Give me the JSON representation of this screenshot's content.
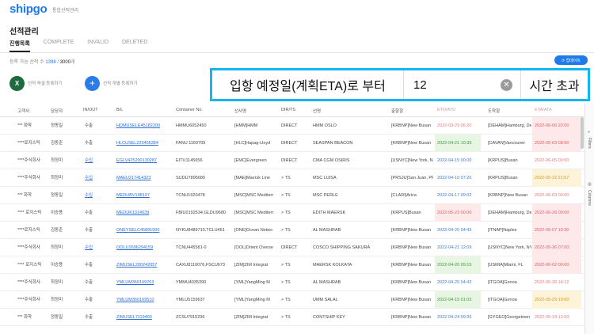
{
  "header": {
    "logo": "shipgo",
    "logo_sub": "통합선적관리"
  },
  "page": {
    "title": "선적관리",
    "tabs": [
      {
        "label": "진행목록",
        "active": true
      },
      {
        "label": "COMPLETE",
        "active": false
      },
      {
        "label": "INVALID",
        "active": false
      },
      {
        "label": "DELETED",
        "active": false
      }
    ],
    "count_prefix": "등록 가능 선적 수 ",
    "count_used": "1398",
    "count_slash": " / ",
    "count_total": "3000",
    "count_suffix": "개",
    "update_button": "⟳ 업데이트"
  },
  "actions": {
    "excel_label": "선적 엑셀 등록하기",
    "single_label": "선적 개별 등록하기"
  },
  "filter": {
    "label": "입항 예정일(계획ETA)로 부터",
    "value": "12",
    "unit": "시간 초과"
  },
  "table": {
    "columns": {
      "customer": "고객사",
      "manager": "담당자",
      "inout": "IN/OUT",
      "bl": "B/L",
      "container": "Container No.",
      "carrier": "선사명",
      "dirts": "DIR/TS",
      "vessel": "선명",
      "pol": "출항항",
      "etd": "ETD",
      "atd": "/ATD",
      "pod": "도착항",
      "eta": "ETA",
      "ata": "/ATA"
    },
    "rows": [
      {
        "customer": "*** 화학",
        "manager": "정동일",
        "inout": "수출",
        "inout_link": false,
        "bl": "HDMUSELE45182200",
        "container": "HMMU6052450",
        "carrier": "[HMM]HMM",
        "dirts": "DIRECT",
        "ts": false,
        "vessel": "HMM OSLO",
        "pol": "[KRBNP]New Busan",
        "etd": "2022-03-29 06:20",
        "etd_style": "none",
        "pod": "[DEHAM]Hamburg, De",
        "eta": "2022-06-06 22:00",
        "eta_style": "pink"
      },
      {
        "customer": "****로지스틱",
        "manager": "김동준",
        "inout": "수출",
        "inout_link": false,
        "bl": "HLCUSEL220455384",
        "container": "FANU 1160709",
        "carrier": "[HLC]Hapag-Lloyd",
        "dirts": "DIRECT",
        "ts": false,
        "vessel": "SEASPAN BEACON",
        "pol": "[KRBNP]New Busan",
        "etd": "2022-04-21 10:35",
        "etd_style": "green",
        "pod": "[CAVAN]Vancouver",
        "eta": "2022-06-03 08:00",
        "eta_style": "pink"
      },
      {
        "customer": "****주식회사",
        "manager": "최정미",
        "inout": "수입",
        "inout_link": true,
        "bl": "EGLV425200130287",
        "container": "EITU1145656",
        "carrier": "[EMC]Evergreen",
        "dirts": "DIRECT",
        "ts": false,
        "vessel": "CMA CGM OSIRIS",
        "pol": "[USNYC]New York, NY",
        "etd": "2022-04-15 00:00",
        "etd_style": "blue",
        "pod": "[KRPUS]Busan",
        "eta": "2022-06-05 00:00",
        "eta_style": "none"
      },
      {
        "customer": "****주식회사",
        "manager": "최정미",
        "inout": "수입",
        "inout_link": true,
        "bl": "MAEU217414323",
        "container": "SUDU7895680",
        "carrier": "[MAE]Maersk Line",
        "dirts": "> TS",
        "ts": true,
        "vessel": "MSC LUISA",
        "pol": "[PRSJU]San Juan, PR",
        "etd": "2022-04-10 07:26",
        "etd_style": "blue",
        "pod": "[KRPUS]Busan",
        "eta": "2022-05-22 21:57",
        "eta_style": "yellow"
      },
      {
        "customer": "*** 화학",
        "manager": "정동일",
        "inout": "수입",
        "inout_link": true,
        "bl": "MEDUBV198107",
        "container": "TCNU1920478",
        "carrier": "[MSC]MSC Mediterr",
        "dirts": "> TS",
        "ts": true,
        "vessel": "MSC PERLE",
        "pol": "[CLARI]Arica",
        "etd": "2022-04-17 09:02",
        "etd_style": "blue",
        "pod": "[KRBNP]New Busan",
        "eta": "2022-06-03 00:00",
        "eta_style": "none"
      },
      {
        "customer": "**** 로지스틱",
        "manager": "이승용",
        "inout": "수출",
        "inout_link": false,
        "bl": "MEDUK1314039",
        "container": "FBIU0192534,GLDU9680",
        "carrier": "[MSC]MSC Mediterr",
        "dirts": "> TS",
        "ts": true,
        "vessel": "EDITH MAERSK",
        "pol": "[KRPUS]Busan",
        "etd": "2022-05-23 00:00",
        "etd_style": "red",
        "pod": "[DEHAM]Hamburg, De",
        "eta": "2022-06-26 00:00",
        "eta_style": "pink"
      },
      {
        "customer": "****로지스틱",
        "manager": "김동준",
        "inout": "수출",
        "inout_link": false,
        "bl": "ONEYSELC45891500",
        "container": "NYKU8489710,TCLU461",
        "carrier": "[ONE]Ocean Netwo",
        "dirts": "> TS",
        "ts": true,
        "vessel": "AL MASHRAB",
        "pol": "[KRBNP]New Busan",
        "etd": "2022-04-20 04:43",
        "etd_style": "blue",
        "pod": "[ITNAP]Naples",
        "eta": "2022-06-07 19:30",
        "eta_style": "pink"
      },
      {
        "customer": "****주식회사",
        "manager": "최정미",
        "inout": "수입",
        "inout_link": true,
        "bl": "OOLU2696294159",
        "container": "TCNU445581-0",
        "carrier": "[OOL]Orient Overse",
        "dirts": "DIRECT",
        "ts": false,
        "vessel": "COSCO SHIPPING SAKURA",
        "pol": "[KRBNP]New Busan",
        "etd": "2022-04-21 12:09",
        "etd_style": "blue",
        "pod": "[USNYC]New York, NY",
        "eta": "2022-05-26 07:00",
        "eta_style": "pink"
      },
      {
        "customer": "**** 로지스틱",
        "manager": "이승용",
        "inout": "수출",
        "inout_link": false,
        "bl": "ZIMUSEL200242057",
        "container": "CAXU8110076,FSCU673",
        "carrier": "[ZIM]ZIM Integrat",
        "dirts": "> TS",
        "ts": true,
        "vessel": "MAERSK KOLKATA",
        "pol": "[KRBNP]New Busan",
        "etd": "2022-04-20 09:15",
        "etd_style": "green",
        "pod": "[USMIA]Miami, FL",
        "eta": "2022-06-02 00:00",
        "eta_style": "pink"
      },
      {
        "customer": "****주식회사",
        "manager": "최정미",
        "inout": "수출",
        "inout_link": false,
        "bl": "YMLUM360169763",
        "container": "YMMU4035390",
        "carrier": "[YML]YangMing M",
        "dirts": "> TS",
        "ts": true,
        "vessel": "AL MASHRAB",
        "pol": "[KRBNP]New Busan",
        "etd": "2022-04-20 04:43",
        "etd_style": "blue",
        "pod": "[ITGOA]Genoa",
        "eta": "2022-05-20 14:12",
        "eta_style": "none"
      },
      {
        "customer": "****주식회사",
        "manager": "최정미",
        "inout": "수출",
        "inout_link": false,
        "bl": "YMLUM360169510",
        "container": "YMLU5159637",
        "carrier": "[YML]YangMing M",
        "dirts": "> TS",
        "ts": true,
        "vessel": "UMM SALAL",
        "pol": "[KRBNP]New Busan",
        "etd": "2022-04-15 01:03",
        "etd_style": "green",
        "pod": "[ITGOA]Genoa",
        "eta": "2022-05-29 10:00",
        "eta_style": "yellow"
      },
      {
        "customer": "*** 화학",
        "manager": "정동일",
        "inout": "수출",
        "inout_link": false,
        "bl": "ZIMUSEL7119403",
        "container": "ZCSU7915236",
        "carrier": "[ZIM]ZIM Integrat",
        "dirts": "> TS",
        "ts": true,
        "vessel": "CONTSHIP KEY",
        "pol": "[KRBNP]New Busan",
        "etd": "2022-04-24 09:35",
        "etd_style": "blue",
        "pod": "[GYGEO]Georgetown",
        "eta": "2022-05-24 12:00",
        "eta_style": "none"
      }
    ]
  },
  "side": {
    "filters": "Filters",
    "columns": "Columns"
  },
  "colors": {
    "brand": "#1e7be8",
    "highlight": "#13b6f0"
  }
}
